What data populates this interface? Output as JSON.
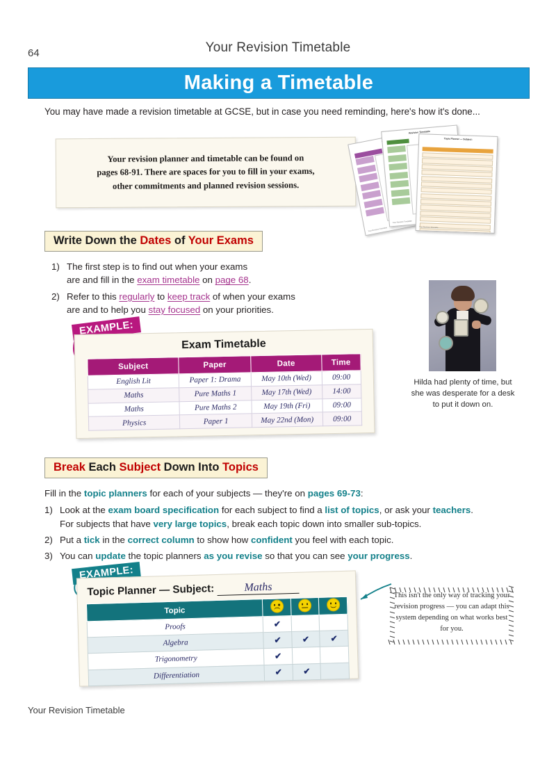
{
  "header": {
    "page_number": "64",
    "running_head": "Your Revision Timetable",
    "title": "Making a Timetable",
    "title_bar_color": "#199BDC"
  },
  "intro": "You may have made a revision timetable at GCSE, but in case you need reminding, here's how it's done...",
  "note_box": {
    "line1": "Your revision planner and timetable can be found on",
    "line2": "pages 68-91.  There are spaces for you to fill in your exams,",
    "line3": "other commitments and planned revision sessions."
  },
  "thumbnails": [
    {
      "name": "revision-planner-sheet-purple",
      "accent": "#B97FBE",
      "title": "Monthly Planner",
      "footer": "Your Revision Timetable"
    },
    {
      "name": "revision-timetable-sheet-green",
      "accent": "#7FAE6E",
      "title": "Revision Timetable",
      "footer": "Your Revision Timetable"
    },
    {
      "name": "topic-planner-sheet-orange",
      "accent": "#E8A33D",
      "title": "Topic Planner — Subject:",
      "footer": "Your Revision Timetable"
    }
  ],
  "section1": {
    "heading_parts": [
      {
        "text": "Write Down the ",
        "color": "black"
      },
      {
        "text": "Dates",
        "color": "red"
      },
      {
        "text": " of ",
        "color": "black"
      },
      {
        "text": "Your Exams",
        "color": "red"
      }
    ],
    "heading_plain": "Write Down the Dates of Your Exams",
    "items": [
      {
        "num": "1)",
        "text": "The first step is to find out when your exams are and fill in the exam timetable on page 68.",
        "emphasis": [
          "exam timetable",
          "page 68"
        ]
      },
      {
        "num": "2)",
        "text": "Refer to this regularly to keep track of when your exams are and to help you stay focused on your priorities.",
        "emphasis": [
          "regularly",
          "keep track",
          "stay focused"
        ]
      }
    ],
    "example_label": "EXAMPLE:",
    "example_tag_color": "#B8187F"
  },
  "exam_timetable": {
    "title": "Exam Timetable",
    "header_color": "#A41A77",
    "columns": [
      "Subject",
      "Paper",
      "Date",
      "Time"
    ],
    "rows": [
      [
        "English Lit",
        "Paper 1: Drama",
        "May 10th (Wed)",
        "09:00"
      ],
      [
        "Maths",
        "Pure Maths 1",
        "May 17th (Wed)",
        "14:00"
      ],
      [
        "Maths",
        "Pure Maths 2",
        "May 19th (Fri)",
        "09:00"
      ],
      [
        "Physics",
        "Paper 1",
        "May 22nd (Mon)",
        "09:00"
      ]
    ]
  },
  "photo": {
    "alt": "woman-holding-clocks-photo",
    "caption": "Hilda had plenty of time, but she was desperate for a desk to put it down on."
  },
  "section2": {
    "heading_parts": [
      {
        "text": "Break",
        "color": "red"
      },
      {
        "text": " Each ",
        "color": "black"
      },
      {
        "text": "Subject",
        "color": "red"
      },
      {
        "text": " Down ",
        "color": "black"
      },
      {
        "text": "Into",
        "color": "black"
      },
      {
        "text": " Topics",
        "color": "red"
      }
    ],
    "heading_plain": "Break Each Subject Down Into Topics",
    "lead": "Fill in the topic planners for each of your subjects — they're on pages 69-73:",
    "items": [
      {
        "num": "1)",
        "text": "Look at the exam board specification for each subject to find a list of topics, or ask your teachers. For subjects that have very large topics, break each topic down into smaller sub-topics."
      },
      {
        "num": "2)",
        "text": "Put a tick in the correct column to show how confident you feel with each topic."
      },
      {
        "num": "3)",
        "text": "You can update the topic planners as you revise so that you can see your progress."
      }
    ],
    "example_label": "EXAMPLE:",
    "example_tag_color": "#13808A"
  },
  "topic_planner": {
    "title": "Topic Planner — Subject:",
    "subject_value": "Maths",
    "header_color": "#13737C",
    "columns": [
      "Topic",
      "face-confused",
      "face-neutral",
      "face-happy"
    ],
    "rows": [
      {
        "topic": "Proofs",
        "ticks": [
          true,
          false,
          false
        ]
      },
      {
        "topic": "Algebra",
        "ticks": [
          true,
          true,
          true
        ]
      },
      {
        "topic": "Trigonometry",
        "ticks": [
          true,
          false,
          false
        ]
      },
      {
        "topic": "Differentiation",
        "ticks": [
          true,
          true,
          false
        ]
      }
    ],
    "tick_glyph": "✔"
  },
  "sunburst_note": "This isn't the only way of tracking your revision progress — you can adapt this system depending on what works best for you.",
  "footer": "Your Revision Timetable"
}
